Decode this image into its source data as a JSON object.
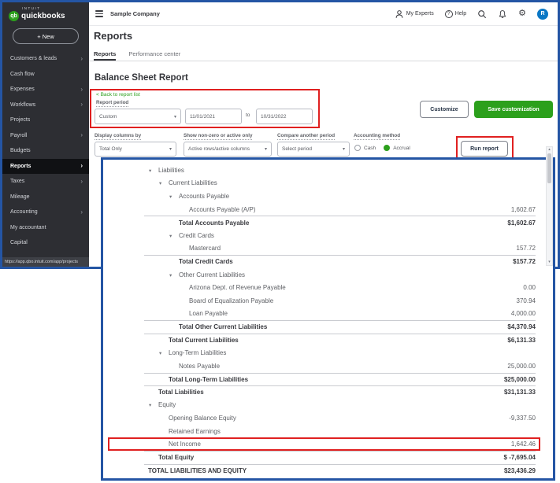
{
  "brand": {
    "intuit": "INTUIT",
    "name": "quickbooks",
    "monogram": "qb"
  },
  "header": {
    "company": "Sample Company",
    "my_experts": "My Experts",
    "help": "Help",
    "avatar_letter": "R"
  },
  "sidebar": {
    "new_button": "+ New",
    "items": [
      {
        "label": "Customers & leads",
        "chevron": true,
        "active": false
      },
      {
        "label": "Cash flow",
        "chevron": false,
        "active": false
      },
      {
        "label": "Expenses",
        "chevron": true,
        "active": false
      },
      {
        "label": "Workflows",
        "chevron": true,
        "active": false
      },
      {
        "label": "Projects",
        "chevron": false,
        "active": false
      },
      {
        "label": "Payroll",
        "chevron": true,
        "active": false
      },
      {
        "label": "Budgets",
        "chevron": false,
        "active": false
      },
      {
        "label": "Reports",
        "chevron": true,
        "active": true
      },
      {
        "label": "Taxes",
        "chevron": true,
        "active": false
      },
      {
        "label": "Mileage",
        "chevron": false,
        "active": false
      },
      {
        "label": "Accounting",
        "chevron": true,
        "active": false
      },
      {
        "label": "My accountant",
        "chevron": false,
        "active": false
      },
      {
        "label": "Capital",
        "chevron": false,
        "active": false
      }
    ],
    "status_url": "https://app.qbo.intuit.com/app/projects"
  },
  "page": {
    "title": "Reports",
    "tabs": [
      {
        "label": "Reports",
        "active": true
      },
      {
        "label": "Performance center",
        "active": false
      }
    ]
  },
  "report": {
    "title": "Balance Sheet Report",
    "back_link": "< Back to report list",
    "period_label": "Report period",
    "period_type": "Custom",
    "date_from": "11/01/2021",
    "to_label": "to",
    "date_to": "10/31/2022",
    "customize_button": "Customize",
    "save_button": "Save customization",
    "filters": {
      "display_columns_label": "Display columns by",
      "display_columns_value": "Total Only",
      "nonzero_label": "Show non-zero or active only",
      "nonzero_value": "Active rows/active columns",
      "compare_label": "Compare another period",
      "compare_value": "Select period",
      "accounting_label": "Accounting method",
      "cash_label": "Cash",
      "accrual_label": "Accrual",
      "accounting_selected": "Accrual",
      "run_button": "Run report"
    }
  },
  "statement": {
    "rows": [
      {
        "label": "Liabilities",
        "value": "",
        "indent": 1,
        "arrow": true
      },
      {
        "label": "Current Liabilities",
        "value": "",
        "indent": 2,
        "arrow": true
      },
      {
        "label": "Accounts Payable",
        "value": "",
        "indent": 3,
        "arrow": true
      },
      {
        "label": "Accounts Payable (A/P)",
        "value": "1,602.67",
        "indent": 4
      },
      {
        "label": "Total Accounts Payable",
        "value": "$1,602.67",
        "indent": 3,
        "bold": true,
        "border": true
      },
      {
        "label": "Credit Cards",
        "value": "",
        "indent": 3,
        "arrow": true
      },
      {
        "label": "Mastercard",
        "value": "157.72",
        "indent": 4
      },
      {
        "label": "Total Credit Cards",
        "value": "$157.72",
        "indent": 3,
        "bold": true,
        "border": true
      },
      {
        "label": "Other Current Liabilities",
        "value": "",
        "indent": 3,
        "arrow": true
      },
      {
        "label": "Arizona Dept. of Revenue Payable",
        "value": "0.00",
        "indent": 4
      },
      {
        "label": "Board of Equalization Payable",
        "value": "370.94",
        "indent": 4
      },
      {
        "label": "Loan Payable",
        "value": "4,000.00",
        "indent": 4
      },
      {
        "label": "Total Other Current Liabilities",
        "value": "$4,370.94",
        "indent": 3,
        "bold": true,
        "border": true
      },
      {
        "label": "Total Current Liabilities",
        "value": "$6,131.33",
        "indent": 2,
        "bold": true,
        "border": true
      },
      {
        "label": "Long-Term Liabilities",
        "value": "",
        "indent": 2,
        "arrow": true
      },
      {
        "label": "Notes Payable",
        "value": "25,000.00",
        "indent": 3
      },
      {
        "label": "Total Long-Term Liabilities",
        "value": "$25,000.00",
        "indent": 2,
        "bold": true,
        "border": true
      },
      {
        "label": "Total Liabilities",
        "value": "$31,131.33",
        "indent": 1,
        "bold": true,
        "border": true
      },
      {
        "label": "Equity",
        "value": "",
        "indent": 1,
        "arrow": true
      },
      {
        "label": "Opening Balance Equity",
        "value": "-9,337.50",
        "indent": 2
      },
      {
        "label": "Retained Earnings",
        "value": "",
        "indent": 2
      },
      {
        "label": "Net Income",
        "value": "1,642.46",
        "indent": 2,
        "highlight": true
      },
      {
        "label": "Total Equity",
        "value": "$ -7,695.04",
        "indent": 1,
        "bold": true,
        "border": true
      },
      {
        "label": "TOTAL LIABILITIES AND EQUITY",
        "value": "$23,436.29",
        "indent": 0,
        "bold": true,
        "border": true
      }
    ]
  },
  "icons": {
    "chevron_right": "›",
    "dropdown_arrow": "▾",
    "collapse_arrow": "▾",
    "scroll_up": "▴",
    "scroll_down": "▾",
    "gear": "⚙",
    "help_q": "?"
  }
}
